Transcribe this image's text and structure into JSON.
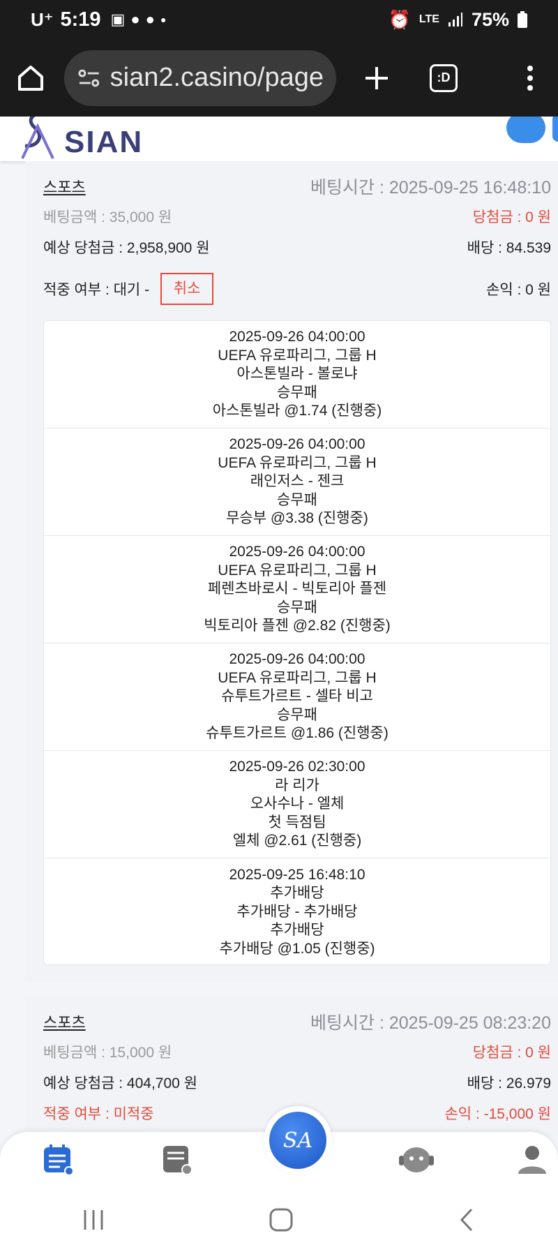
{
  "status_bar": {
    "carrier": "U⁺",
    "time": "5:19",
    "network": "LTE",
    "battery": "75%",
    "icons": [
      "gallery-icon",
      "talk-icon",
      "won-icon",
      "dot-icon",
      "alarm-icon",
      "signal-icon",
      "battery-icon"
    ]
  },
  "browser": {
    "url": "sian2.casino/page",
    "tab_label": ":D"
  },
  "site": {
    "brand": "SIAN",
    "logo_mark": "SA"
  },
  "bets": [
    {
      "type": "스포츠",
      "bet_time": "베팅시간 : 2025-09-25 16:48:10",
      "bet_amount": "베팅금액 : 35,000 원",
      "win_amount": "당첨금 : 0 원",
      "expected": "예상 당첨금 : 2,958,900 원",
      "odds": "배당 : 84.539",
      "status": "적중 여부 : 대기 -",
      "cancel_label": "취소",
      "profit": "손익 : 0 원",
      "matches": [
        {
          "time": "2025-09-26 04:00:00",
          "league": "UEFA 유로파리그, 그룹 H",
          "teams": "아스톤빌라 - 볼로냐",
          "market": "승무패",
          "pick": "아스톤빌라 @1.74 (진행중)"
        },
        {
          "time": "2025-09-26 04:00:00",
          "league": "UEFA 유로파리그, 그룹 H",
          "teams": "래인저스 - 젠크",
          "market": "승무패",
          "pick": "무승부 @3.38 (진행중)"
        },
        {
          "time": "2025-09-26 04:00:00",
          "league": "UEFA 유로파리그, 그룹 H",
          "teams": "페렌츠바로시 - 빅토리아 플젠",
          "market": "승무패",
          "pick": "빅토리아 플젠 @2.82 (진행중)"
        },
        {
          "time": "2025-09-26 04:00:00",
          "league": "UEFA 유로파리그, 그룹 H",
          "teams": "슈투트가르트 - 셀타 비고",
          "market": "승무패",
          "pick": "슈투트가르트 @1.86 (진행중)"
        },
        {
          "time": "2025-09-26 02:30:00",
          "league": "라 리가",
          "teams": "오사수나 - 엘체",
          "market": "첫 득점팀",
          "pick": "엘체 @2.61 (진행중)"
        },
        {
          "time": "2025-09-25 16:48:10",
          "league": "추가배당",
          "teams": "추가배당 - 추가배당",
          "market": "추가배당",
          "pick": "추가배당 @1.05 (진행중)"
        }
      ]
    },
    {
      "type": "스포츠",
      "bet_time": "베팅시간 : 2025-09-25 08:23:20",
      "bet_amount": "베팅금액 : 15,000 원",
      "win_amount": "당첨금 : 0 원",
      "expected": "예상 당첨금 : 404,700 원",
      "odds": "배당 : 26.979",
      "status": "적중 여부 : 미적중",
      "profit": "손익 : -15,000 원"
    }
  ],
  "colors": {
    "accent_red": "#e34a3c",
    "brand_blue": "#2a6bd6",
    "brand_navy": "#3b3f78"
  }
}
